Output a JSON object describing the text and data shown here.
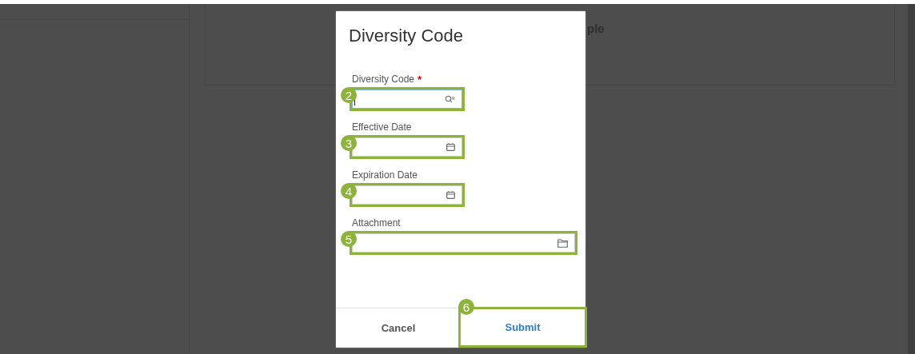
{
  "background": {
    "card_text": "ple"
  },
  "dialog": {
    "title": "Diversity Code",
    "fields": [
      {
        "label": "Diversity Code",
        "required_mark": "*",
        "kind": "lookup",
        "focused": true,
        "callout": "2"
      },
      {
        "label": "Effective Date",
        "kind": "date",
        "focused": false,
        "callout": "3"
      },
      {
        "label": "Expiration Date",
        "kind": "date",
        "focused": false,
        "callout": "4"
      },
      {
        "label": "Attachment",
        "kind": "file",
        "focused": false,
        "callout": "5"
      }
    ],
    "buttons": [
      {
        "label": "Cancel",
        "kind": "secondary"
      },
      {
        "label": "Submit",
        "kind": "primary",
        "callout": "6"
      }
    ]
  }
}
